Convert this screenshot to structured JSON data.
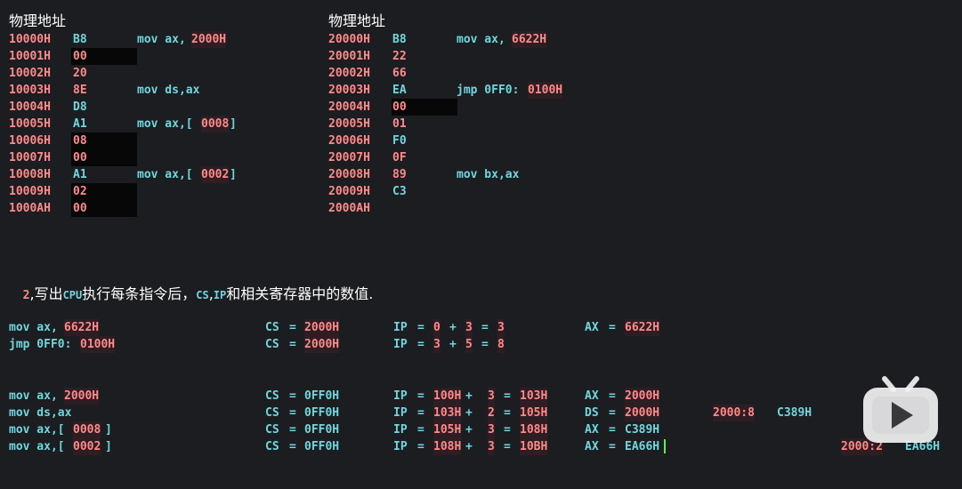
{
  "left_table": {
    "title": "物理地址",
    "rows": [
      {
        "addr": "10000H",
        "byte": "B8",
        "instr": "mov ax,",
        "arg": "2000H"
      },
      {
        "addr": "10001H",
        "byte": "00"
      },
      {
        "addr": "10002H",
        "byte": "20"
      },
      {
        "addr": "10003H",
        "byte": "8E",
        "instr": "mov ds,ax"
      },
      {
        "addr": "10004H",
        "byte": "D8"
      },
      {
        "addr": "10005H",
        "byte": "A1",
        "instr": "mov ax,[",
        "arg": "0008",
        "tail": "]"
      },
      {
        "addr": "10006H",
        "byte": "08"
      },
      {
        "addr": "10007H",
        "byte": "00"
      },
      {
        "addr": "10008H",
        "byte": "A1",
        "instr": "mov ax,[",
        "arg": "0002",
        "tail": "]"
      },
      {
        "addr": "10009H",
        "byte": "02"
      },
      {
        "addr": "1000AH",
        "byte": "00"
      }
    ]
  },
  "right_table": {
    "title": "物理地址",
    "rows": [
      {
        "addr": "20000H",
        "byte": "B8",
        "instr": "mov ax,",
        "arg": "6622H"
      },
      {
        "addr": "20001H",
        "byte": "22"
      },
      {
        "addr": "20002H",
        "byte": "66"
      },
      {
        "addr": "20003H",
        "byte": "EA",
        "instr": "jmp 0FF0:",
        "arg": "0100H"
      },
      {
        "addr": "20004H",
        "byte": "00"
      },
      {
        "addr": "20005H",
        "byte": "01"
      },
      {
        "addr": "20006H",
        "byte": "F0"
      },
      {
        "addr": "20007H",
        "byte": "0F"
      },
      {
        "addr": "20008H",
        "byte": "89",
        "instr": "mov bx,ax"
      },
      {
        "addr": "20009H",
        "byte": "C3"
      },
      {
        "addr": "2000AH",
        "byte": ""
      }
    ]
  },
  "question": {
    "num": "2",
    "p1": ",写出",
    "cpu": "CPU",
    "p2": "执行每条指令后，",
    "cs": "CS",
    "comma": ",",
    "ip": "IP",
    "p3": "和相关寄存器中的数值."
  },
  "group1": [
    {
      "ins_a": "mov ax,",
      "ins_b": "6622H",
      "cs_val": "2000H",
      "ip_a": "0",
      "ip_b": "3",
      "ip_c": "3",
      "reg": "AX",
      "reg_val": "6622H"
    },
    {
      "ins_a": "jmp 0FF0:",
      "ins_b": "0100H",
      "cs_val": "2000H",
      "ip_a": "3",
      "ip_b": "5",
      "ip_c": "8"
    }
  ],
  "group2": [
    {
      "ins_a": "mov ax,",
      "ins_b": "2000H",
      "cs_val": "0FF0H",
      "ip_a": "100H",
      "ip_b": "3",
      "ip_c": "103H",
      "reg": "AX",
      "reg_val": "2000H"
    },
    {
      "ins_a": "mov ds,ax",
      "cs_val": "0FF0H",
      "ip_a": "103H",
      "ip_b": "2",
      "ip_c": "105H",
      "reg": "DS",
      "reg_val": "2000H",
      "note_addr": "2000:8",
      "note_val": "C389H"
    },
    {
      "ins_a": "mov ax,[",
      "ins_b": "0008",
      "ins_c": "]",
      "cs_val": "0FF0H",
      "ip_a": "105H",
      "ip_b": "3",
      "ip_c": "108H",
      "reg": "AX",
      "reg_val": "C389H"
    },
    {
      "ins_a": "mov ax,[",
      "ins_b": "0002",
      "ins_c": "]",
      "cs_val": "0FF0H",
      "ip_a": "108H",
      "ip_b": "3",
      "ip_c": "10BH",
      "reg": "AX",
      "reg_val": "EA66H",
      "note_addr": "2000:2",
      "note_val": "EA66H"
    }
  ],
  "labels": {
    "cs": "CS",
    "ip": "IP",
    "eq": "=",
    "plus": "+"
  },
  "colors": {
    "background": "#1c1d21",
    "cyan": "#6fd8de",
    "pink": "#ff8a8a",
    "cursor": "#5cf05c",
    "play_badge": "#f2f2f2"
  },
  "overlay": {
    "icon": "bilibili-play-icon"
  }
}
